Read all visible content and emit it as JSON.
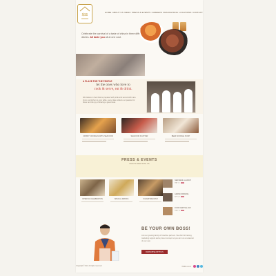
{
  "brand": {
    "logo_text": "$11"
  },
  "nav": {
    "items": [
      "HOME",
      "ABOUT US",
      "MENU",
      "PRESS & EVENTS",
      "CAREERS",
      "FRANCHISING",
      "LOCATIONS",
      "CONTACT"
    ]
  },
  "hero": {
    "text_main": "Celebrate the carnival of a taste of china in three different dishes. ",
    "text_highlight": "All taste you",
    "text_tail": " all at one cost."
  },
  "cooks": {
    "lead": "A PLACE FOR THE PEOPLE",
    "headline_1": "let the ones who love to",
    "headline_2": "cook & serve, eat & drink.",
    "body": "We believe in food that is prepared with pride and served with care. From our kitchen to your table, every plate reflects our passion for flavor and the joy of sharing a great meal."
  },
  "cards": [
    {
      "title": "CRISPY NOODLES WITH SEAFOOD"
    },
    {
      "title": "SEAFOOD PLATTER"
    },
    {
      "title": "BEEF NOODLE SOUP"
    }
  ],
  "press": {
    "title": "PRESS & EVENTS",
    "subtitle": "WHAT'S NEW WITH US",
    "cards": [
      {
        "title": "OPENING CELEBRATION"
      },
      {
        "title": "SPECIAL DRINKS"
      },
      {
        "title": "SIGNATURE DISH"
      }
    ],
    "list": [
      {
        "title": "NEW MENU LAUNCH",
        "date": "MAY 12"
      },
      {
        "title": "GRAND OPENING",
        "date": "APR 28"
      },
      {
        "title": "FOOD FESTIVAL DAY",
        "date": "MAR 15"
      }
    ]
  },
  "boss": {
    "title": "BE YOUR OWN BOSS!",
    "body": "Join our growing family of franchise partners. We offer full training, marketing support and a proven concept so you can run a restaurant of your own.",
    "button": "FRANCHISE WITH US"
  },
  "footer": {
    "text": "Copyright © $11. All rights reserved.",
    "social_label": "Follow us on",
    "social_colors": [
      "#d94c8a",
      "#3b82c4",
      "#56b8e0"
    ]
  },
  "colors": {
    "accent": "#9a2b2b",
    "page_bg": "#fbf9f4",
    "outer_bg": "#f5f3ee",
    "press_band": "#f8f1d6"
  }
}
